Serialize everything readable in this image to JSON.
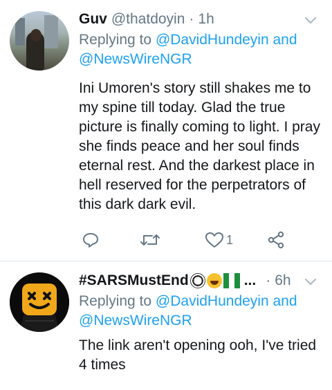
{
  "tweets": [
    {
      "name": "Guv",
      "handle": "@thatdoyin",
      "separator": "·",
      "time": "1h",
      "replying_prefix": "Replying to ",
      "replying_user1": "@DavidHundeyin",
      "replying_and": " and",
      "replying_user2": "@NewsWireNGR",
      "text": "Ini Umoren's story still shakes me to my spine till today. Glad the true picture is finally coming to light. I pray she finds peace and her soul finds eternal rest. And the darkest place in hell reserved for the perpetrators of this dark dark evil.",
      "like_count": "1"
    },
    {
      "name": "#SARSMustEnd",
      "name_ellipsis": "...",
      "separator": "·",
      "time": "6h",
      "replying_prefix": "Replying to ",
      "replying_user1": "@DavidHundeyin",
      "replying_and": " and",
      "replying_user2": "@NewsWireNGR",
      "text": "The link aren't opening ooh, I've tried 4 times"
    }
  ],
  "colors": {
    "link": "#1da1f2",
    "muted": "#657786",
    "text": "#14171a",
    "divider": "#e1e8ed"
  },
  "icons": [
    "reply-icon",
    "retweet-icon",
    "like-icon",
    "share-icon",
    "chevron-down-icon"
  ]
}
